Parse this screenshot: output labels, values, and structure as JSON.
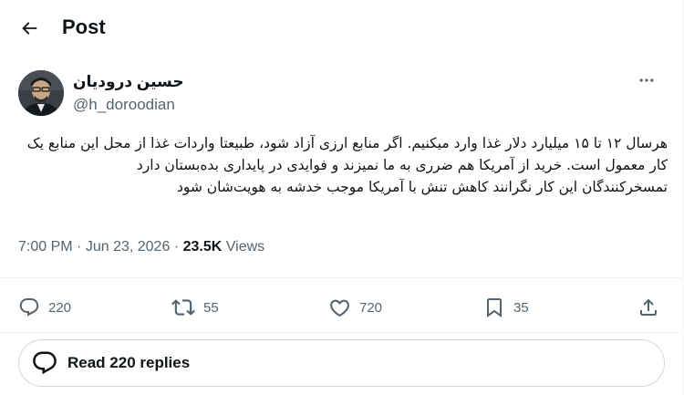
{
  "header": {
    "title": "Post",
    "back_icon": "back-arrow-icon"
  },
  "author": {
    "name": "حسین درودیان",
    "handle": "@h_doroodian",
    "avatar_icon": "avatar-photo"
  },
  "post": {
    "text": "هرسال ۱۲ تا ۱۵ میلیارد دلار غذا وارد میکنیم. اگر منابع ارزی آزاد شود، طبیعتا واردات غذا از محل این منابع یک کار معمول است. خرید از آمریکا هم ضرری به ما نمیزند و فوایدی در پایداری بده‌بستان دارد\nتمسخرکنندگان این کار نگرانند کاهش تنش با آمریکا موجب خدشه به هویت‌شان شود",
    "time": "7:00 PM",
    "separator": "·",
    "date": "Jun 23, 2026",
    "views_count": "23.5K",
    "views_label": "Views"
  },
  "actions": {
    "replies": "220",
    "reposts": "55",
    "likes": "720",
    "bookmarks": "35"
  },
  "read_replies": {
    "label": "Read 220 replies"
  },
  "colors": {
    "text": "#0f1419",
    "secondary": "#536471",
    "border": "#cfd9de",
    "divider": "#eff3f4"
  }
}
